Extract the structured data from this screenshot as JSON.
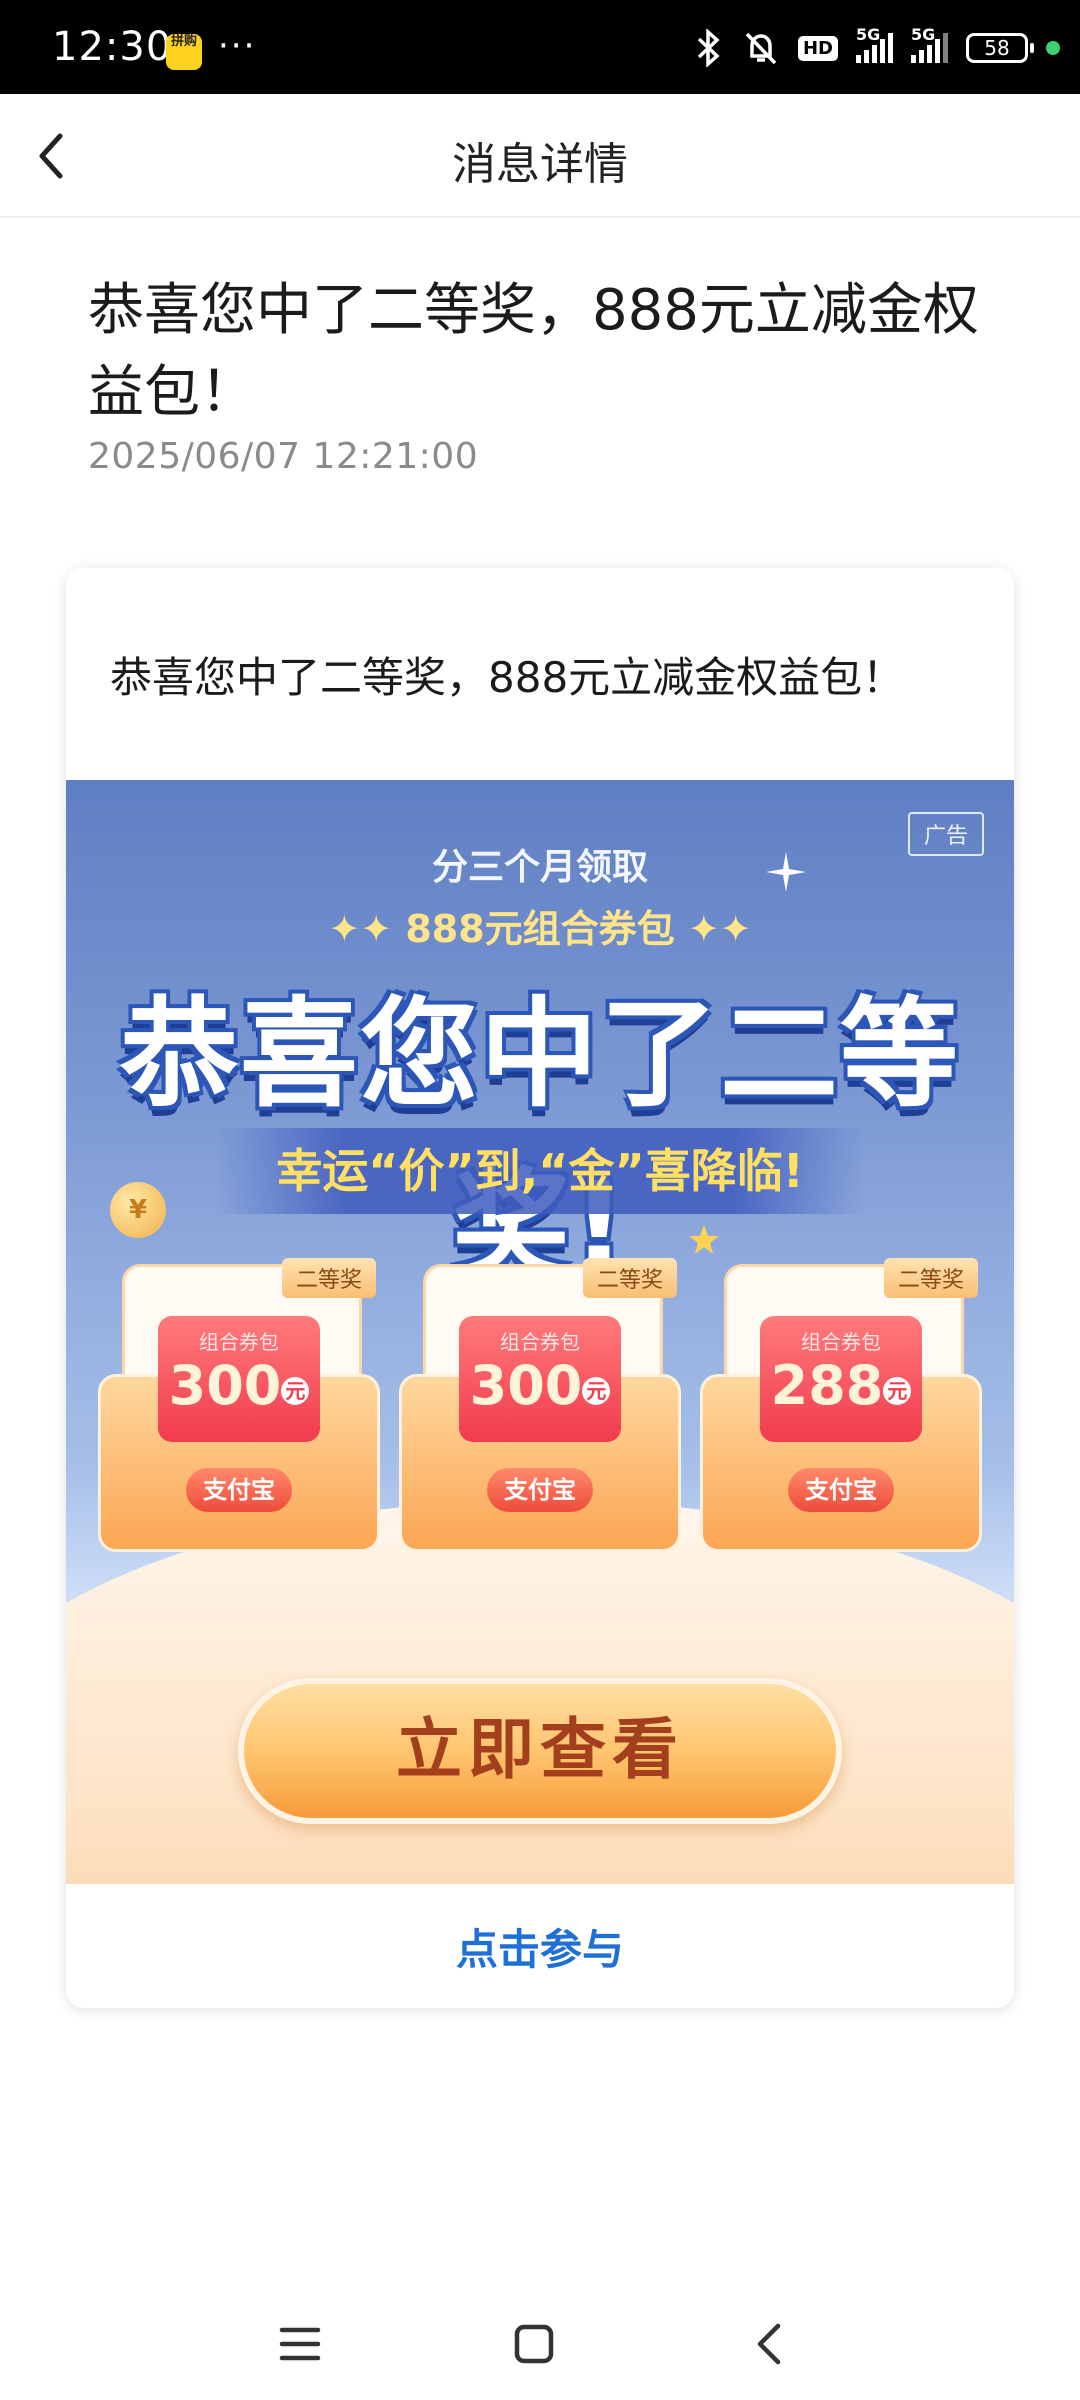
{
  "status_bar": {
    "time": "12:30",
    "app_icon_text": "拼购",
    "more": "···",
    "hd": "HD",
    "net1": "5G",
    "net2": "5G",
    "battery": "58"
  },
  "nav": {
    "title": "消息详情"
  },
  "message": {
    "title": "恭喜您中了二等奖，888元立减金权益包！",
    "time": "2025/06/07  12:21:00"
  },
  "card": {
    "text": "恭喜您中了二等奖，888元立减金权益包！",
    "banner": {
      "ad_label": "广告",
      "subtitle1": "分三个月领取",
      "subtitle2": "✦✦ 888元组合券包 ✦✦",
      "headline": "恭喜您中了二等奖!",
      "lucky": "幸运“价”到,“金”喜降临!",
      "coin": "¥",
      "coupons": [
        {
          "ribbon": "二等奖",
          "label": "组合券包",
          "amount": "300",
          "unit": "元",
          "pay": "支付宝"
        },
        {
          "ribbon": "二等奖",
          "label": "组合券包",
          "amount": "300",
          "unit": "元",
          "pay": "支付宝"
        },
        {
          "ribbon": "二等奖",
          "label": "组合券包",
          "amount": "288",
          "unit": "元",
          "pay": "支付宝"
        }
      ],
      "cta": "立即查看"
    },
    "link": "点击参与"
  },
  "icons": {
    "back": "chevron-left-icon",
    "menu": "menu-icon",
    "home": "home-icon",
    "nav_back": "back-icon"
  },
  "colors": {
    "link": "#1e6fd6",
    "banner_top": "#5f7fc3",
    "cta": "#ffc26a"
  }
}
